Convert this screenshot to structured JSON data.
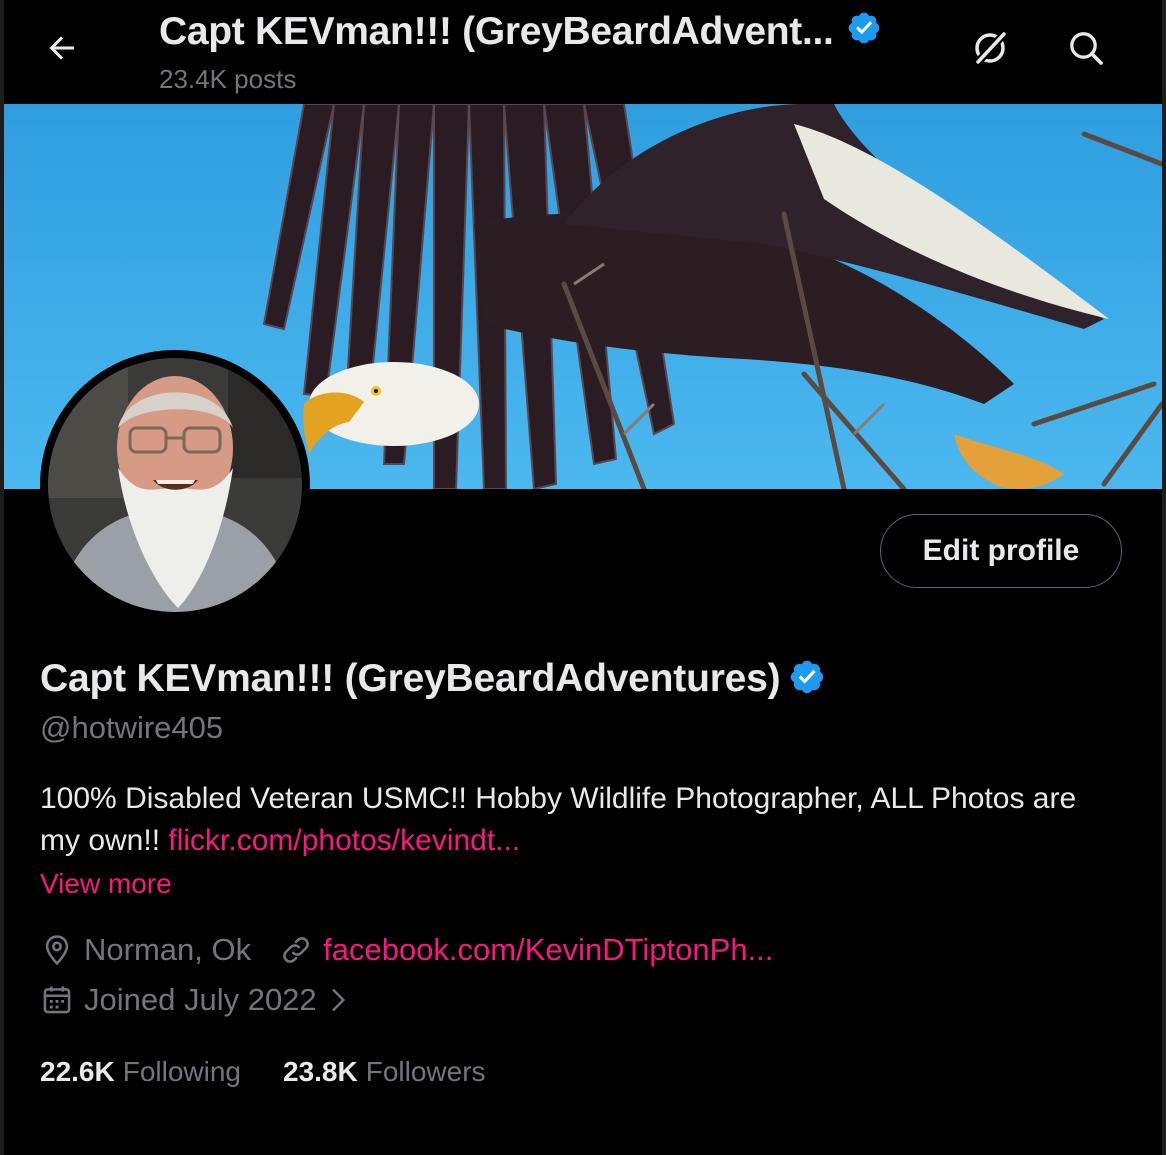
{
  "header": {
    "title": "Capt KEVman!!! (GreyBeardAdvent...",
    "posts_count": "23.4K posts",
    "back_icon": "arrow-left-icon",
    "grok_icon": "grok-icon",
    "search_icon": "search-icon"
  },
  "profile": {
    "display_name": "Capt KEVman!!! (GreyBeardAdventures)",
    "handle": "@hotwire405",
    "verified": true,
    "verified_color": "#1d9bf0",
    "edit_label": "Edit profile",
    "bio_text": "100% Disabled Veteran USMC!!  Hobby Wildlife Photographer, ALL Photos are my own!! ",
    "bio_link": "flickr.com/photos/kevindt...",
    "view_more": "View more",
    "location": "Norman, Ok",
    "website": "facebook.com/KevinDTiptonPh...",
    "joined": "Joined July 2022",
    "following_count": "22.6K",
    "following_label": "Following",
    "followers_count": "23.8K",
    "followers_label": "Followers"
  },
  "colors": {
    "background": "#000000",
    "accent_link": "#f91880",
    "secondary_text": "#71767b",
    "primary_text": "#e7e9ea"
  }
}
